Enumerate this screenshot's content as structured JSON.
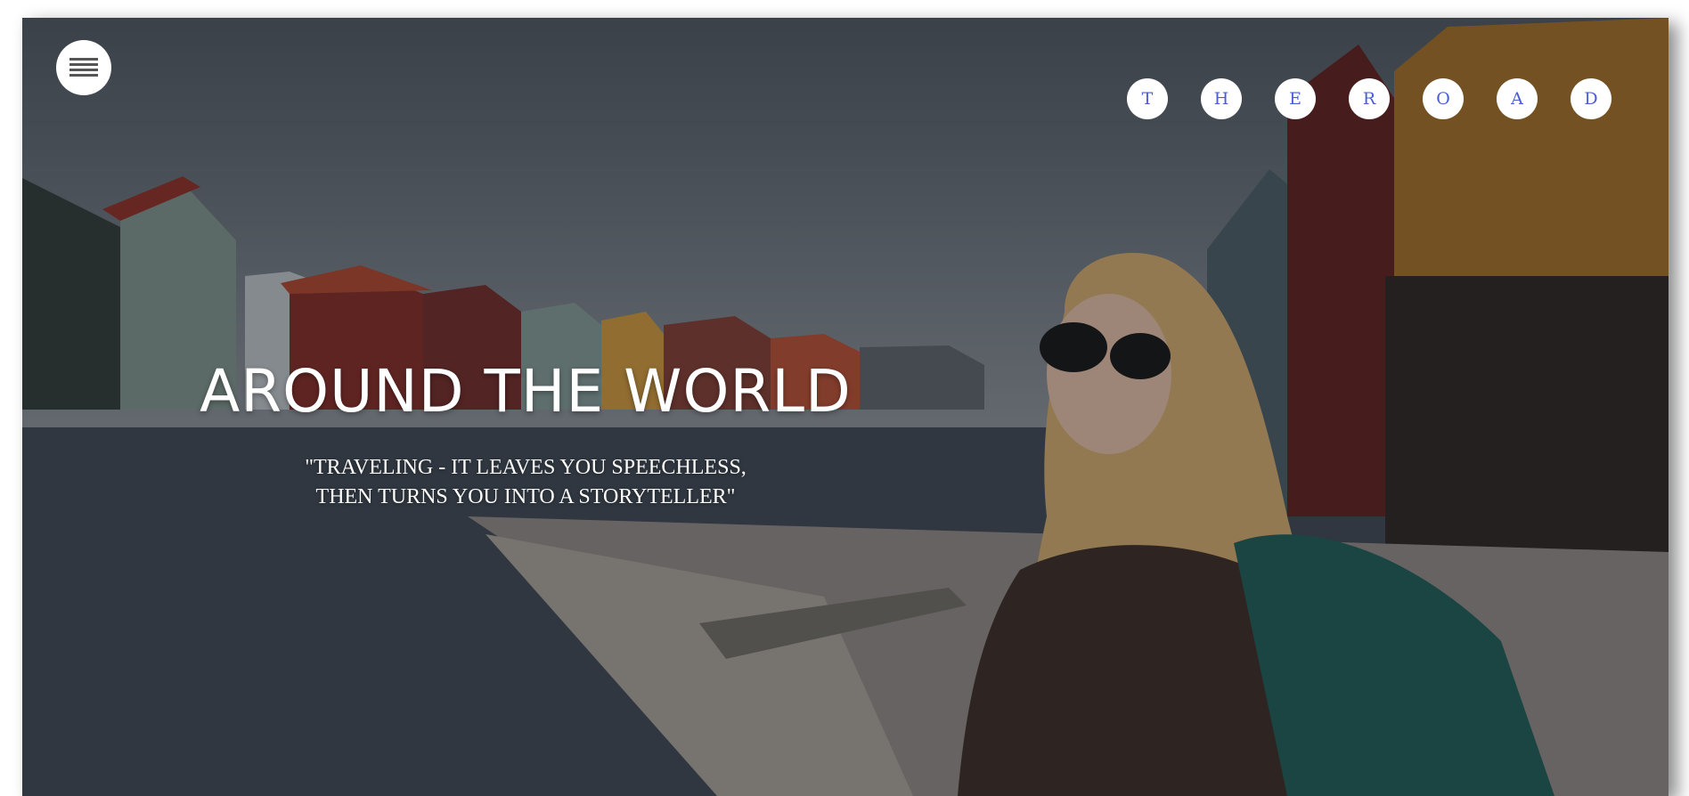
{
  "hero": {
    "title": "AROUND THE WORLD",
    "quote_line1": "\"TRAVELING - IT LEAVES YOU SPEECHLESS,",
    "quote_line2": "THEN TURNS YOU INTO A STORYTELLER\""
  },
  "nav": {
    "menu_icon": "hamburger-icon",
    "letters": [
      "T",
      "H",
      "E",
      "R",
      "O",
      "A",
      "D"
    ]
  },
  "colors": {
    "letter_text": "#4a5cd6",
    "circle_bg": "#ffffff",
    "title_text": "#ffffff"
  }
}
